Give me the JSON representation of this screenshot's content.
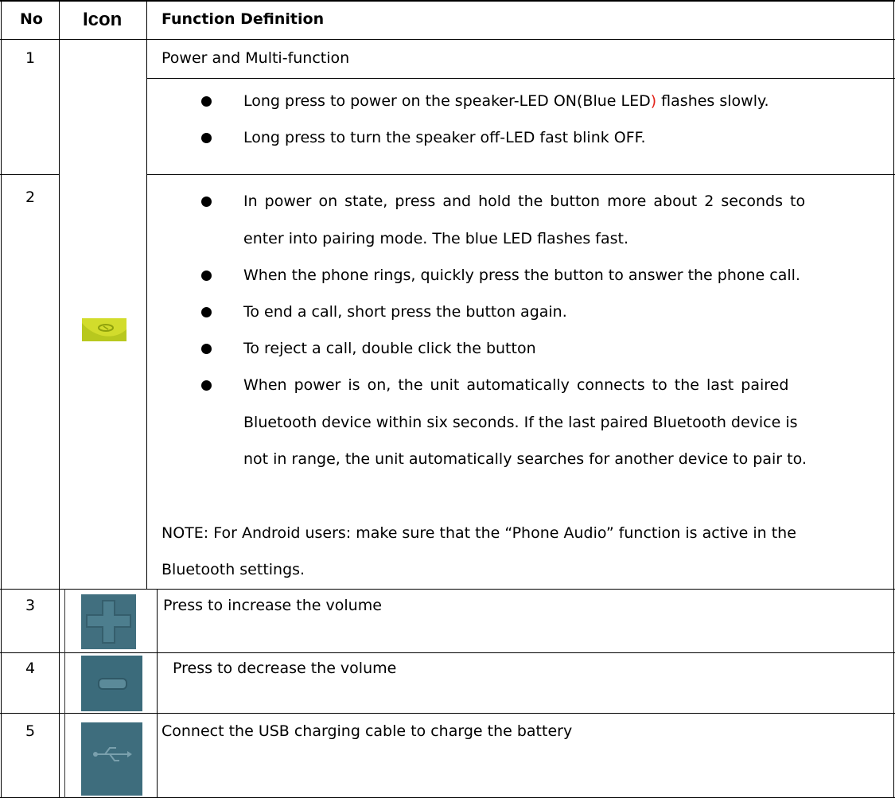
{
  "table": {
    "headers": {
      "no": "No",
      "icon": "Icon",
      "function": "Function Definition"
    },
    "rows": [
      {
        "no": "1",
        "title": "Power and Multi-function",
        "bullets": [
          {
            "before": "Long press to power on the speaker-LED ON(Blue LED",
            "red": ")",
            "after": " flashes slowly."
          },
          {
            "text": "Long press to turn the speaker off-LED fast blink OFF."
          }
        ]
      },
      {
        "no": "2",
        "bullets": [
          {
            "lines": [
              "In power on state, press and hold the button more about 2 seconds to",
              "enter into pairing mode. The blue LED flashes fast."
            ]
          },
          {
            "text": "When the phone rings, quickly press the button to answer the phone call."
          },
          {
            "text": "To end a call, short press the button again."
          },
          {
            "text": "To reject a call, double click the button"
          },
          {
            "lines": [
              "When power is on, the unit automatically connects to the last paired",
              "Bluetooth device within six seconds. If the last paired Bluetooth device is",
              "not in range, the unit automatically searches for another device to pair to."
            ]
          }
        ],
        "note": [
          "NOTE: For Android users: make sure that the “Phone Audio” function is active in the",
          "Bluetooth settings."
        ]
      },
      {
        "no": "3",
        "text": "Press to increase the volume"
      },
      {
        "no": "4",
        "text": "Press to decrease the volume"
      },
      {
        "no": "5",
        "text": "Connect the USB charging cable to charge the battery"
      }
    ]
  },
  "icons": {
    "multifunction": {
      "name": "multifunction-button-icon",
      "color": "#c8d82a"
    },
    "plus": {
      "name": "volume-plus-icon",
      "color": "#3f6e7e"
    },
    "minus": {
      "name": "volume-minus-icon",
      "color": "#3f6e7e"
    },
    "usb": {
      "name": "usb-port-icon",
      "color": "#3f6e7e"
    }
  }
}
